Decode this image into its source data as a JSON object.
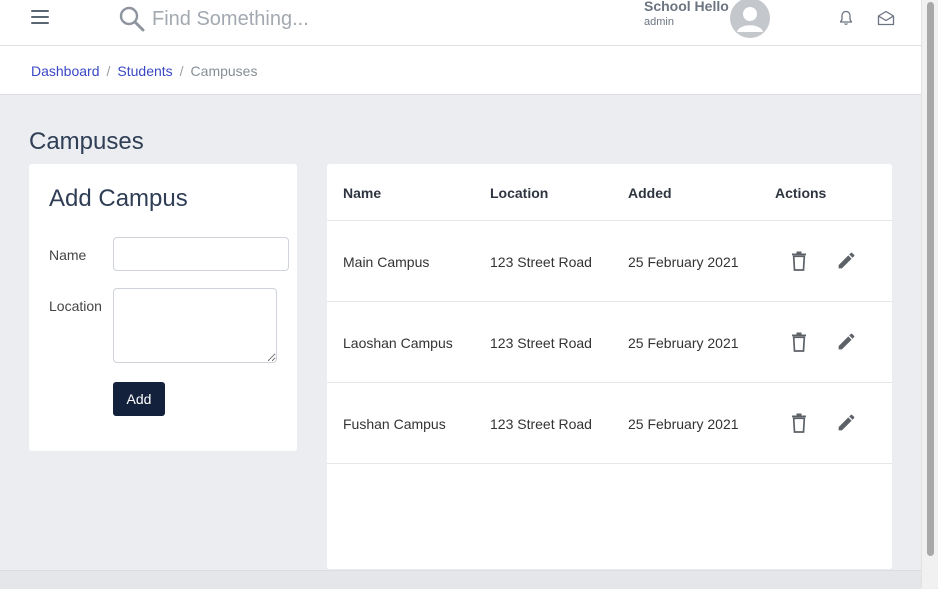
{
  "topbar": {
    "search_placeholder": "Find Something...",
    "user_name": "School Hello",
    "user_role": "admin",
    "icons": [
      "menu-icon",
      "search-icon",
      "avatar-icon",
      "bell-icon",
      "mail-icon"
    ]
  },
  "breadcrumb": {
    "items": [
      "Dashboard",
      "Students",
      "Campuses"
    ],
    "separator": "/"
  },
  "page": {
    "title": "Campuses"
  },
  "add_form": {
    "title": "Add Campus",
    "name_label": "Name",
    "location_label": "Location",
    "name_value": "",
    "location_value": "",
    "submit_label": "Add"
  },
  "table": {
    "headers": [
      "Name",
      "Location",
      "Added",
      "Actions"
    ],
    "rows": [
      {
        "name": "Main Campus",
        "location": "123 Street Road",
        "added": "25 February 2021"
      },
      {
        "name": "Laoshan Campus",
        "location": "123 Street Road",
        "added": "25 February 2021"
      },
      {
        "name": "Fushan Campus",
        "location": "123 Street Road",
        "added": "25 February 2021"
      }
    ]
  },
  "colors": {
    "primary_button": "#13213c",
    "link": "#3a48c4",
    "background": "#ebedf0"
  }
}
